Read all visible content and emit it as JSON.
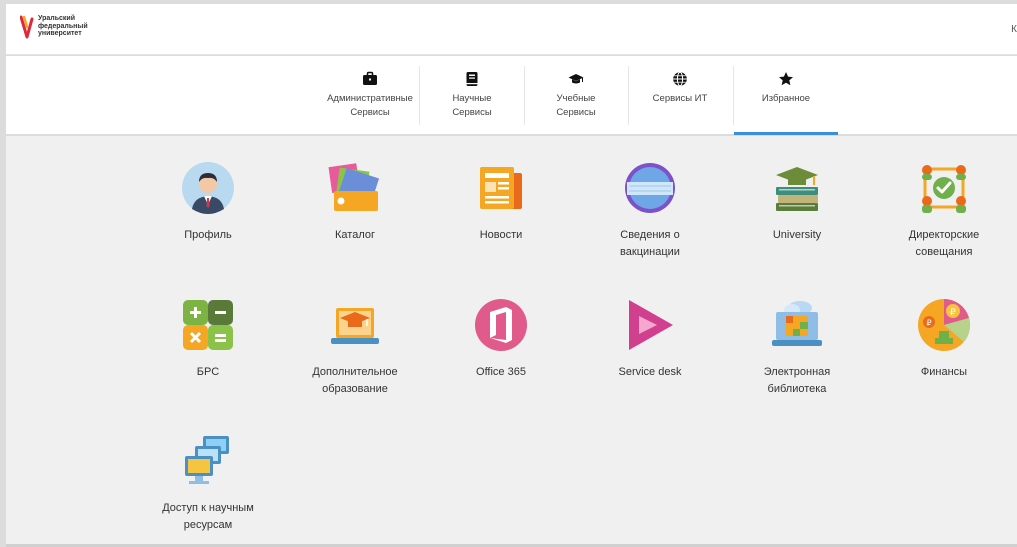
{
  "header": {
    "logo_text": "Уральский\nфедеральный\nуниверситет",
    "right_text": "К"
  },
  "nav": {
    "tabs": [
      {
        "label": "Административные\nСервисы",
        "icon": "briefcase-icon"
      },
      {
        "label": "Научные\nСервисы",
        "icon": "book-icon"
      },
      {
        "label": "Учебные\nСервисы",
        "icon": "graduation-cap-icon"
      },
      {
        "label": "Сервисы ИТ",
        "icon": "globe-icon"
      },
      {
        "label": "Избранное",
        "icon": "star-icon"
      }
    ],
    "active_index": 4
  },
  "tiles": [
    {
      "label": "Профиль",
      "icon": "profile-icon"
    },
    {
      "label": "Каталог",
      "icon": "catalog-icon"
    },
    {
      "label": "Новости",
      "icon": "news-icon"
    },
    {
      "label": "Сведения о\nвакцинации",
      "icon": "vaccination-icon"
    },
    {
      "label": "University",
      "icon": "university-books-icon"
    },
    {
      "label": "Директорские\nсовещания",
      "icon": "meetings-icon"
    },
    {
      "label": "БРС",
      "icon": "calculator-icon"
    },
    {
      "label": "Дополнительное\nобразование",
      "icon": "education-laptop-icon"
    },
    {
      "label": "Office 365",
      "icon": "office-icon"
    },
    {
      "label": "Service desk",
      "icon": "service-desk-icon"
    },
    {
      "label": "Электронная\nбиблиотека",
      "icon": "library-icon"
    },
    {
      "label": "Финансы",
      "icon": "finance-icon"
    },
    {
      "label": "Доступ к научным\nресурсам",
      "icon": "network-access-icon"
    }
  ],
  "colors": {
    "accent": "#3b8fd9",
    "logo_red": "#e0283c",
    "logo_orange": "#f5a623"
  }
}
